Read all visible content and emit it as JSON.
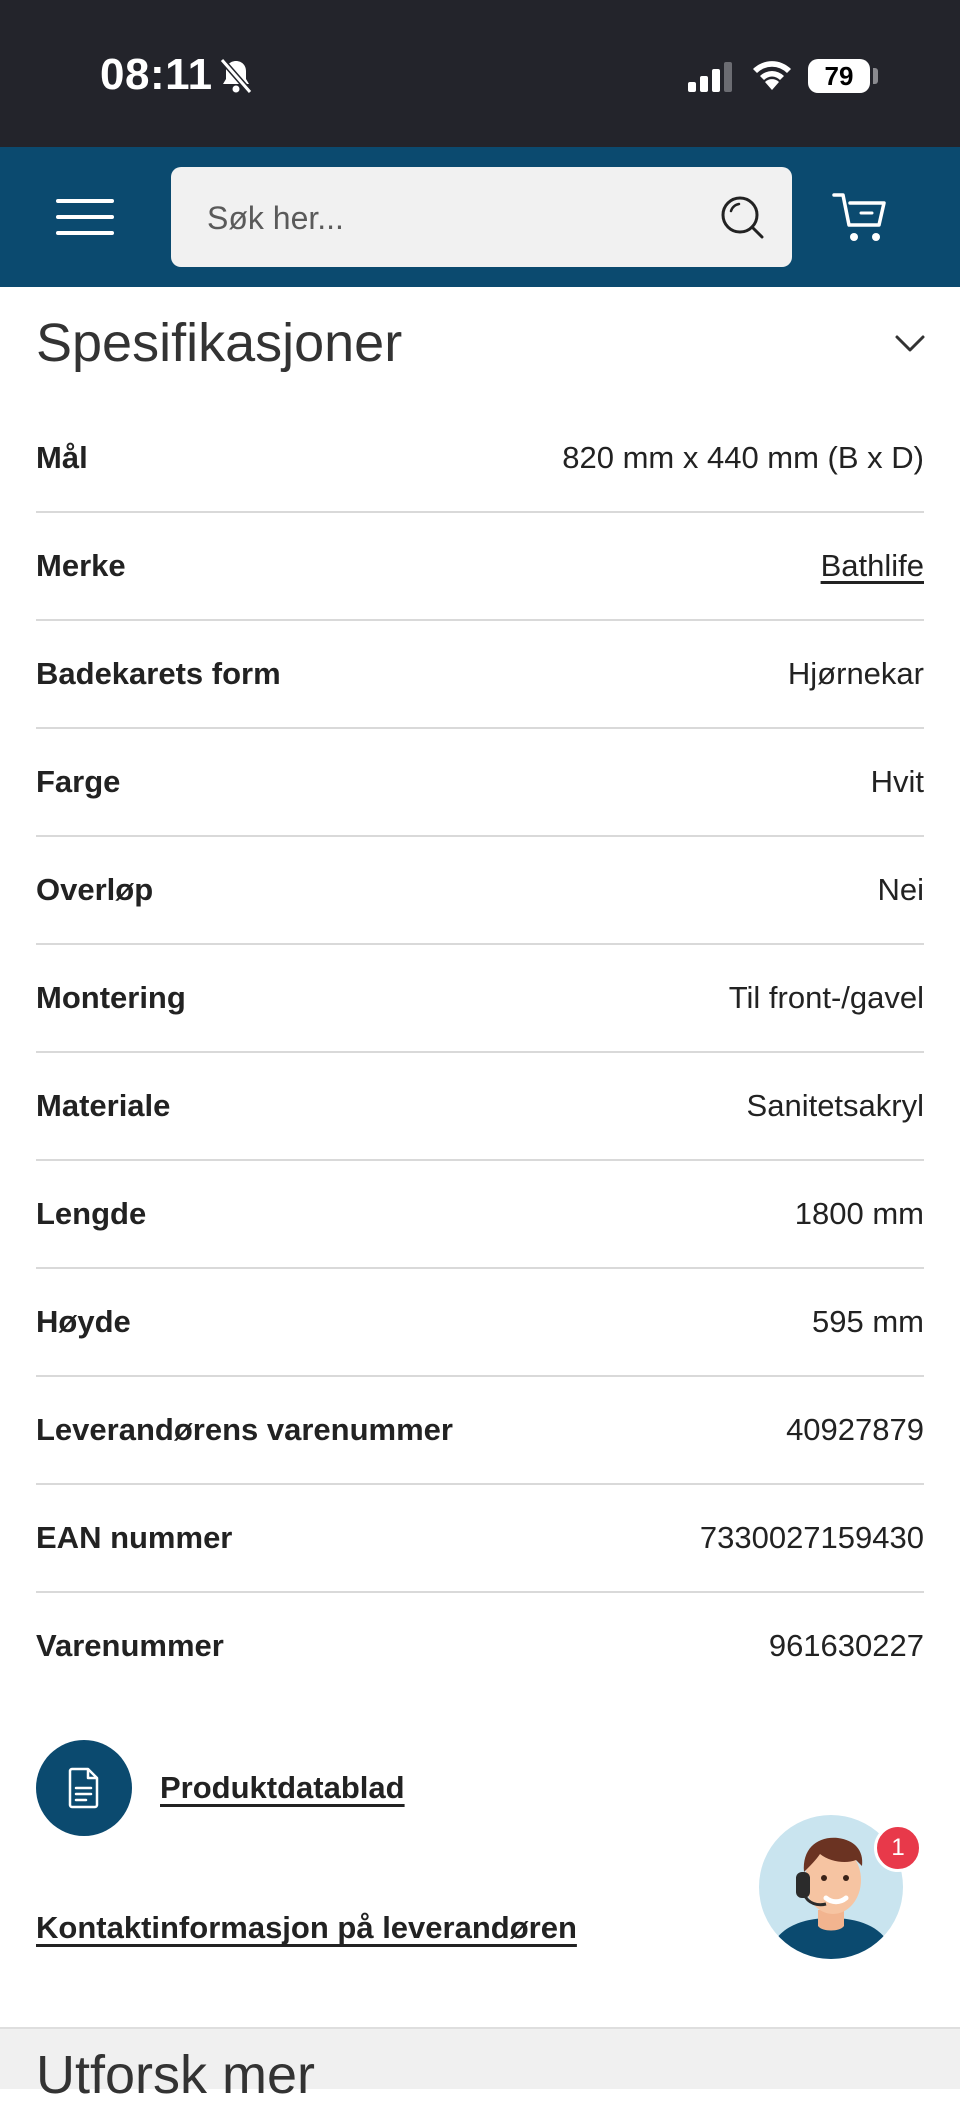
{
  "status_bar": {
    "time": "08:11",
    "battery": "79",
    "icons": [
      "bell-slash-icon",
      "signal-icon",
      "wifi-icon",
      "battery-icon"
    ]
  },
  "header": {
    "search_placeholder": "Søk her...",
    "icons": [
      "menu-icon",
      "search-icon",
      "cart-icon"
    ],
    "background_color": "#0b4a6f"
  },
  "specs_section": {
    "title": "Spesifikasjoner",
    "rows": [
      {
        "label": "Mål",
        "value": "820 mm x 440 mm (B x D)"
      },
      {
        "label": "Merke",
        "value": "Bathlife"
      },
      {
        "label": "Badekarets form",
        "value": "Hjørnekar"
      },
      {
        "label": "Farge",
        "value": "Hvit"
      },
      {
        "label": "Overløp",
        "value": "Nei"
      },
      {
        "label": "Montering",
        "value": "Til front-/gavel"
      },
      {
        "label": "Materiale",
        "value": "Sanitetsakryl"
      },
      {
        "label": "Lengde",
        "value": "1800 mm"
      },
      {
        "label": "Høyde",
        "value": "595 mm"
      },
      {
        "label": "Leverandørens varenummer",
        "value": "40927879"
      },
      {
        "label": "EAN nummer",
        "value": "7330027159430"
      },
      {
        "label": "Varenummer",
        "value": "961630227"
      }
    ]
  },
  "links": {
    "datasheet": "Produktdatablad",
    "supplier_contact": "Kontaktinformasjon på leverandøren"
  },
  "chat": {
    "badge_count": "1"
  },
  "footer": {
    "next_section_title": "Utforsk mer"
  }
}
